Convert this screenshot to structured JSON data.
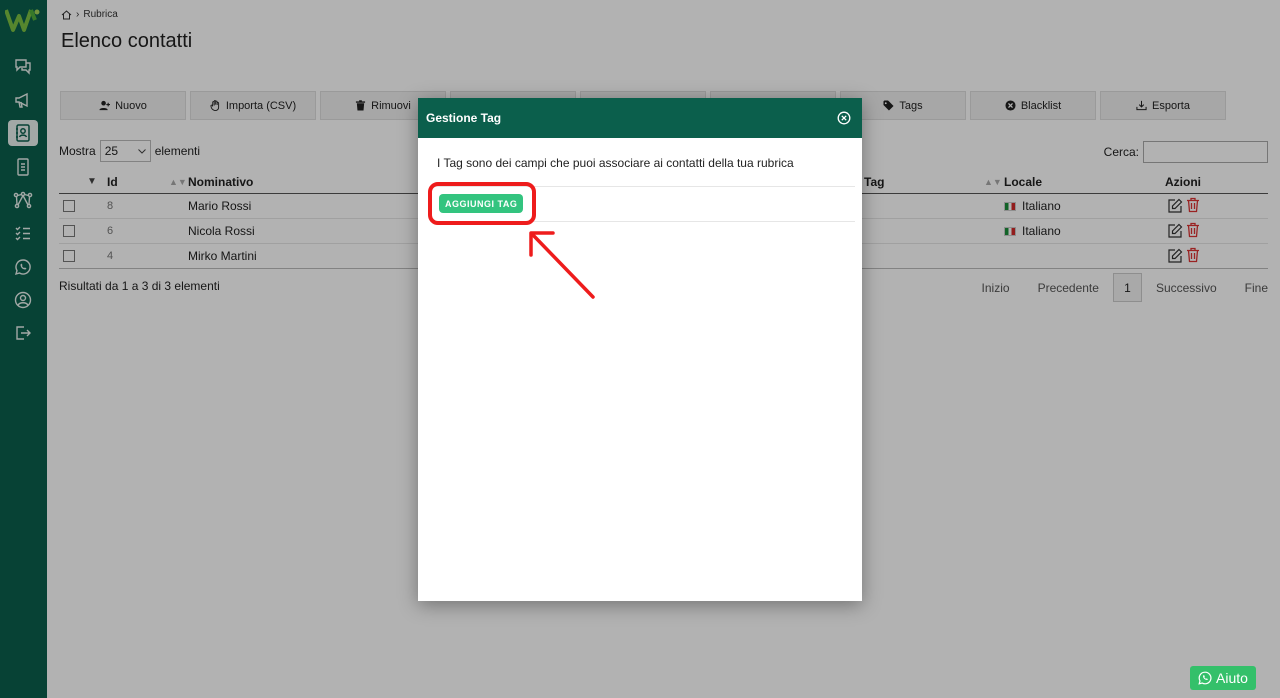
{
  "breadcrumb": {
    "current": "Rubrica"
  },
  "page": {
    "title": "Elenco contatti"
  },
  "toolbar": {
    "buttons": [
      {
        "label": "Nuovo",
        "icon": "user-icon"
      },
      {
        "label": "Importa (CSV)",
        "icon": "hand-icon"
      },
      {
        "label": "Rimuovi",
        "icon": "trash-icon"
      },
      {
        "label": "",
        "icon": ""
      },
      {
        "label": "",
        "icon": ""
      },
      {
        "label": "",
        "icon": ""
      },
      {
        "label": "Tags",
        "icon": "tag-icon"
      },
      {
        "label": "Blacklist",
        "icon": "block-icon"
      },
      {
        "label": "Esporta",
        "icon": "download-icon"
      }
    ]
  },
  "list_controls": {
    "show_prefix": "Mostra",
    "page_size": "25",
    "show_suffix": "elementi",
    "search_label": "Cerca:",
    "search_value": ""
  },
  "table": {
    "headers": {
      "id": "Id",
      "name": "Nominativo",
      "tag": "Tag",
      "locale": "Locale",
      "actions": "Azioni"
    },
    "rows": [
      {
        "id": "8",
        "name": "Mario Rossi",
        "locale": "Italiano"
      },
      {
        "id": "6",
        "name": "Nicola Rossi",
        "locale": "Italiano"
      },
      {
        "id": "4",
        "name": "Mirko Martini",
        "locale": ""
      }
    ]
  },
  "results_text": "Risultati da 1 a 3 di 3 elementi",
  "pagination": {
    "first": "Inizio",
    "prev": "Precedente",
    "current": "1",
    "next": "Successivo",
    "last": "Fine"
  },
  "modal": {
    "title": "Gestione Tag",
    "description": "I Tag sono dei campi che puoi associare ai contatti della tua rubrica",
    "add_button": "AGGIUNGI TAG"
  },
  "help": {
    "label": "Aiuto"
  },
  "colors": {
    "primary": "#0b5f4c",
    "accent_green": "#33c47f",
    "annotation_red": "#ee1c1c"
  }
}
